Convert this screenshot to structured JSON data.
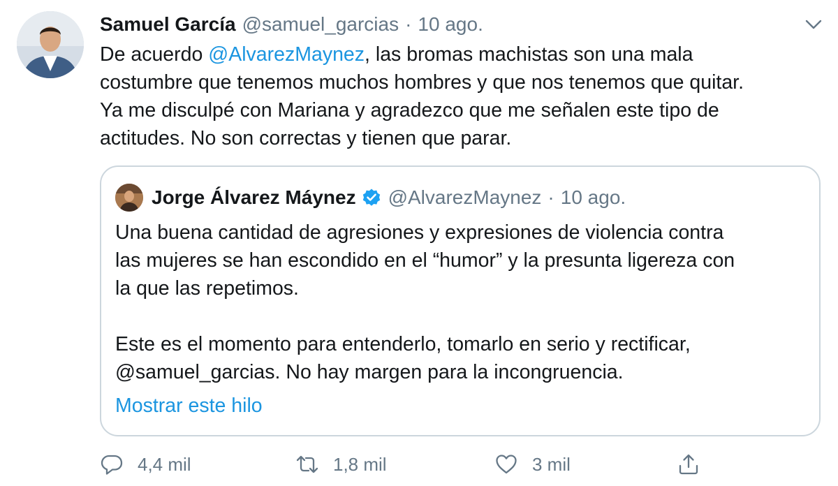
{
  "tweet": {
    "author_name": "Samuel García",
    "author_handle": "@samuel_garcias",
    "separator": "·",
    "date": "10 ago.",
    "text_lines": [
      {
        "before": "De acuerdo ",
        "mention": "@AlvarezMaynez",
        "after": ", las bromas machistas son una mala"
      },
      "costumbre que tenemos muchos hombres y que nos tenemos que quitar.",
      "Ya me disculpé con Mariana y agradezco que me señalen este tipo de",
      "actitudes. No son correctas y tienen que parar."
    ]
  },
  "quote": {
    "author_name": "Jorge Álvarez Máynez",
    "verified": true,
    "author_handle": "@AlvarezMaynez",
    "separator": "·",
    "date": "10 ago.",
    "paragraph1": [
      "Una buena cantidad de agresiones y expresiones de violencia contra",
      "las mujeres se han escondido en el “humor” y la presunta ligereza con",
      "la que las repetimos."
    ],
    "paragraph2_line1": "Este es el momento para entenderlo, tomarlo en serio y rectificar,",
    "paragraph2_line2": {
      "mention": "@samuel_garcias",
      "after": ". No hay margen para la incongruencia."
    },
    "show_thread": "Mostrar este hilo"
  },
  "actions": {
    "replies": "4,4 mil",
    "retweets": "1,8 mil",
    "likes": "3 mil"
  },
  "colors": {
    "link": "#1b95e0",
    "secondary_text": "#657786",
    "border": "#ccd6dd",
    "verified": "#1da1f2"
  },
  "icons": [
    "chevron-down-icon",
    "verified-badge-icon",
    "reply-icon",
    "retweet-icon",
    "like-icon",
    "share-icon"
  ]
}
